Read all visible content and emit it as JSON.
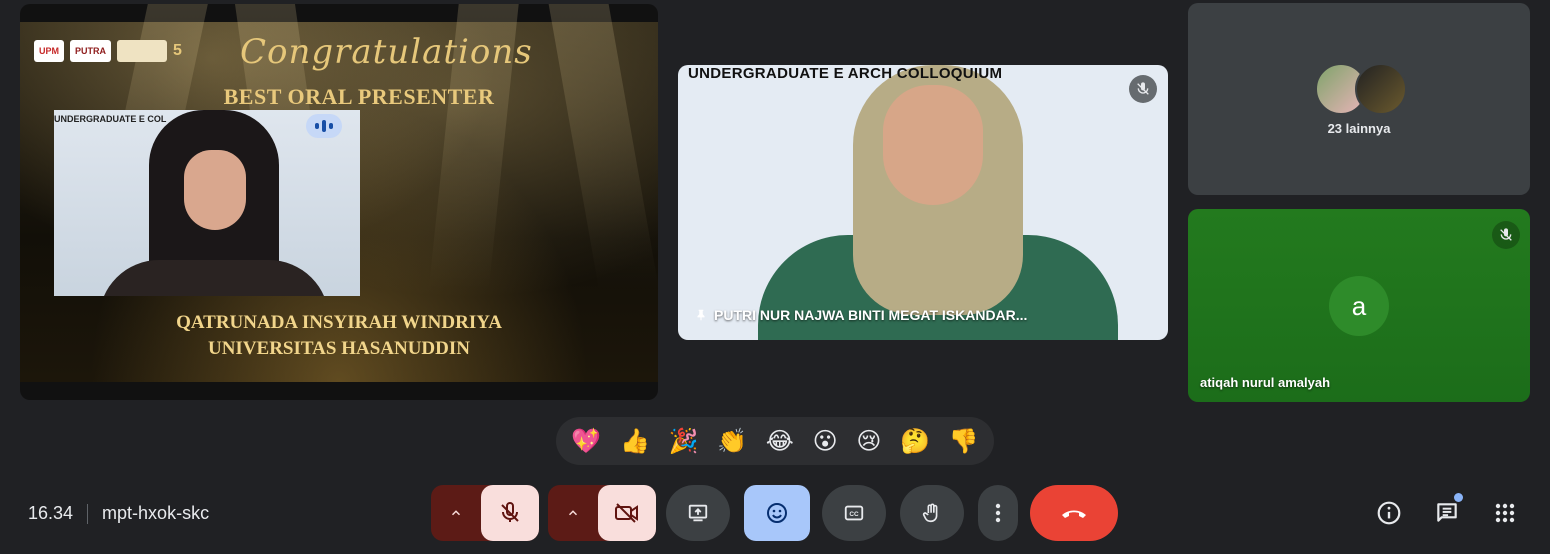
{
  "presentation": {
    "logos": [
      "UPM",
      "PUTRA"
    ],
    "heading": "Congratulations",
    "subheading": "BEST ORAL PRESENTER",
    "inner_banner": "UNDERGRADUATE E        COL",
    "winner_name": "QATRUNADA INSYIRAH WINDRIYA",
    "winner_university": "UNIVERSITAS HASANUDDIN"
  },
  "center_tile": {
    "banner": "UNDERGRADUATE E                   ARCH COLLOQUIUM",
    "participant_name": "PUTRI NUR NAJWA BINTI MEGAT ISKANDAR...",
    "muted": true
  },
  "others_tile": {
    "label": "23 lainnya"
  },
  "atiqah_tile": {
    "initial": "a",
    "name": "atiqah nurul amalyah",
    "muted": true
  },
  "reactions": [
    "💖",
    "👍",
    "🎉",
    "👏",
    "😂",
    "😮",
    "😢",
    "🤔",
    "👎"
  ],
  "meeting": {
    "time": "16.34",
    "code": "mpt-hxok-skc"
  },
  "colors": {
    "leave": "#ea4335",
    "reactions_active": "#a8c7fa",
    "muted_bg": "#f9dedc",
    "muted_group": "#5c1b16"
  }
}
